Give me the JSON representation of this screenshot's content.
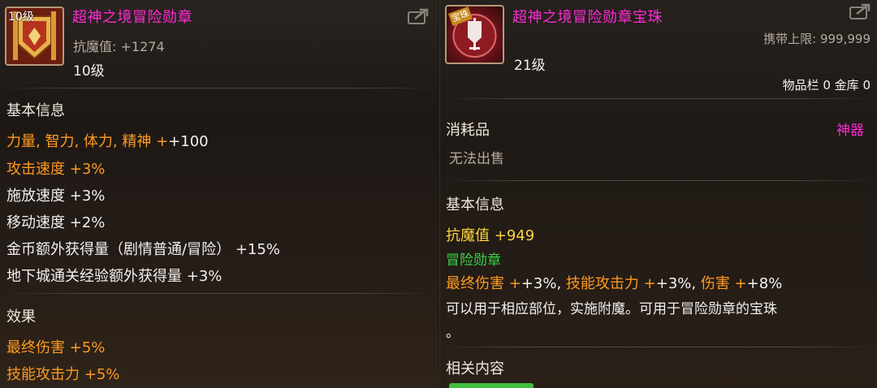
{
  "left": {
    "icon_badge": "10级",
    "title": "超神之境冒险勋章",
    "stat_label": "抗魔值:",
    "stat_value": "+1274",
    "level": "10级",
    "section_basic": "基本信息",
    "basic": [
      {
        "label": "力量, 智力, 体力, 精神",
        "value": "+100",
        "label_color": "orange",
        "value_color": "white"
      },
      {
        "label": "攻击速度",
        "value": "+3%",
        "label_color": "orange",
        "value_color": "orange"
      },
      {
        "label": "施放速度",
        "value": "+3%",
        "label_color": "white",
        "value_color": "white"
      },
      {
        "label": "移动速度",
        "value": "+2%",
        "label_color": "white",
        "value_color": "white"
      },
      {
        "label": "金币额外获得量（剧情普通/冒险）",
        "value": "+15%",
        "label_color": "white",
        "value_color": "white"
      },
      {
        "label": "地下城通关经验额外获得量",
        "value": "+3%",
        "label_color": "white",
        "value_color": "white"
      }
    ],
    "section_effect": "效果",
    "effects": [
      {
        "label": "最终伤害",
        "value": "+5%"
      },
      {
        "label": "技能攻击力",
        "value": "+5%"
      }
    ]
  },
  "right": {
    "icon_badge": "宝珠",
    "title": "超神之境冒险勋章宝珠",
    "carry_limit": "携带上限: 999,999",
    "level": "21级",
    "storage": "物品栏 0 金库 0",
    "type": "消耗品",
    "rarity": "神器",
    "sell": "无法出售",
    "section_basic": "基本信息",
    "resist_label": "抗魔值",
    "resist_value": "+949",
    "slot": "冒险勋章",
    "bonus": {
      "a_label": "最终伤害",
      "a_value": "+3%,",
      "b_label": "技能攻击力",
      "b_value": "+3%,",
      "c_label": "伤害",
      "c_value": "+8%"
    },
    "desc_line1": "可以用于相应部位，实施附魔。可用于冒险勋章的宝珠",
    "desc_line2": "。",
    "section_related": "相关内容"
  },
  "icons": [
    "share-icon",
    "medal-icon",
    "orb-icon"
  ],
  "colors": {
    "title": "#ff2bd6",
    "orange": "#ff9a1f",
    "yellow": "#ffd43b",
    "green": "#39d64a"
  }
}
